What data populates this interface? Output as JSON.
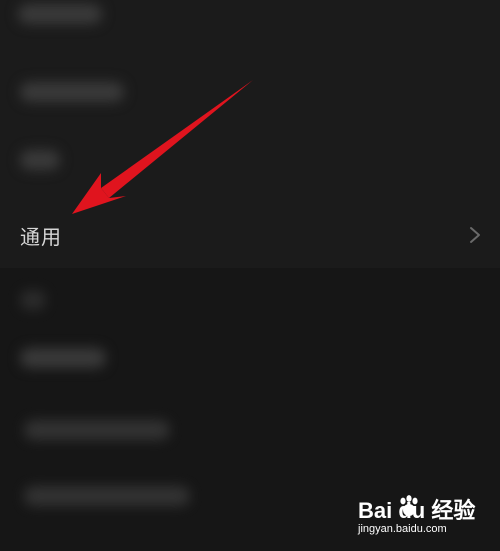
{
  "settings": {
    "general_label": "通用"
  },
  "icons": {
    "chevron": "chevron-right-icon",
    "arrow": "red-pointer-arrow"
  },
  "colors": {
    "background": "#191919",
    "text": "#d6d6d6",
    "arrow": "#e0141e",
    "chevron": "#6a6a6a"
  },
  "watermark": {
    "brand": "Bai du 经验",
    "url": "jingyan.baidu.com"
  }
}
